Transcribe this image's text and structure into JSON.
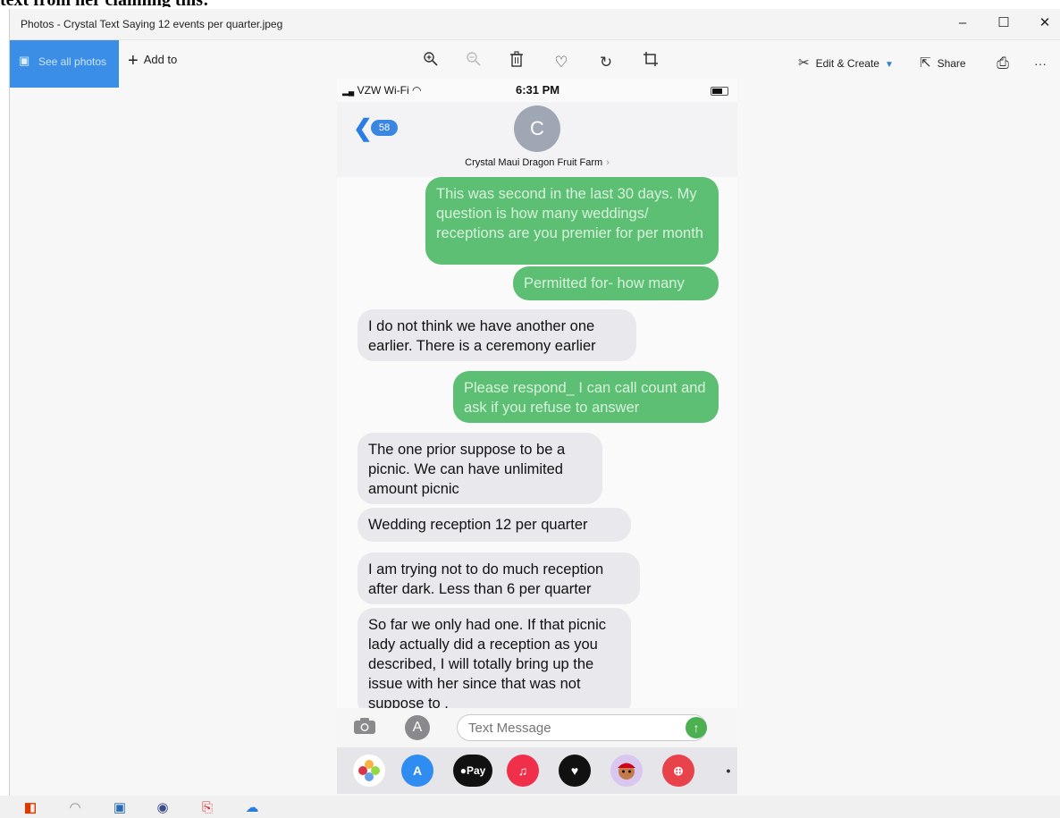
{
  "caption": "text from her claiming this:",
  "window": {
    "title": "Photos - Crystal Text Saying 12 events per quarter.jpeg",
    "minimize_glyph": "–",
    "maximize_glyph": "☐",
    "close_glyph": "✕"
  },
  "toolbar": {
    "see_all_label": "See all photos",
    "add_to_label": "Add to",
    "edit_create_label": "Edit & Create",
    "share_label": "Share",
    "more_glyph": "···",
    "icons": [
      "zoom-in-icon",
      "zoom-out-icon",
      "delete-icon",
      "favorite-icon",
      "rotate-icon",
      "crop-icon",
      "edit-create-icon",
      "share-icon",
      "print-icon"
    ]
  },
  "phone": {
    "status": {
      "carrier": "VZW Wi-Fi",
      "time": "6:31 PM"
    },
    "header": {
      "back_count": "58",
      "avatar_letter": "C",
      "contact_name": "Crystal Maui Dragon Fruit Farm"
    },
    "messages": [
      {
        "from": "me",
        "text": "This was second in the last 30 days. My question is how many weddings/ receptions are you premier for per month"
      },
      {
        "from": "me",
        "text": "Permitted for- how many"
      },
      {
        "from": "them",
        "text": "I do not think we have another one earlier. There is a ceremony earlier"
      },
      {
        "from": "me",
        "text": "Please respond_ I can call count and ask if you refuse to answer"
      },
      {
        "from": "them",
        "text": "The one prior suppose to be a picnic. We can have unlimited amount picnic"
      },
      {
        "from": "them",
        "text": "Wedding reception 12 per quarter"
      },
      {
        "from": "them",
        "text": "I am trying not to do much reception after dark. Less than 6 per quarter"
      },
      {
        "from": "them",
        "text": "So far we only had one. If that picnic lady actually did a reception as you described, I will totally bring up the issue with her since that was not suppose to ."
      }
    ],
    "composer": {
      "placeholder": "Text Message",
      "send_glyph": "↑"
    },
    "app_strip": [
      "photos-app-icon",
      "app-store-icon",
      "apple-pay-icon",
      "music-app-icon",
      "heart-app-icon",
      "memoji-app-icon",
      "search-web-icon",
      "more-apps-icon"
    ],
    "apple_pay_label": "Pay"
  },
  "colors": {
    "outgoing_bubble": "#5cbf73",
    "incoming_bubble": "#e8e8ed",
    "accent": "#3a8ee6"
  }
}
